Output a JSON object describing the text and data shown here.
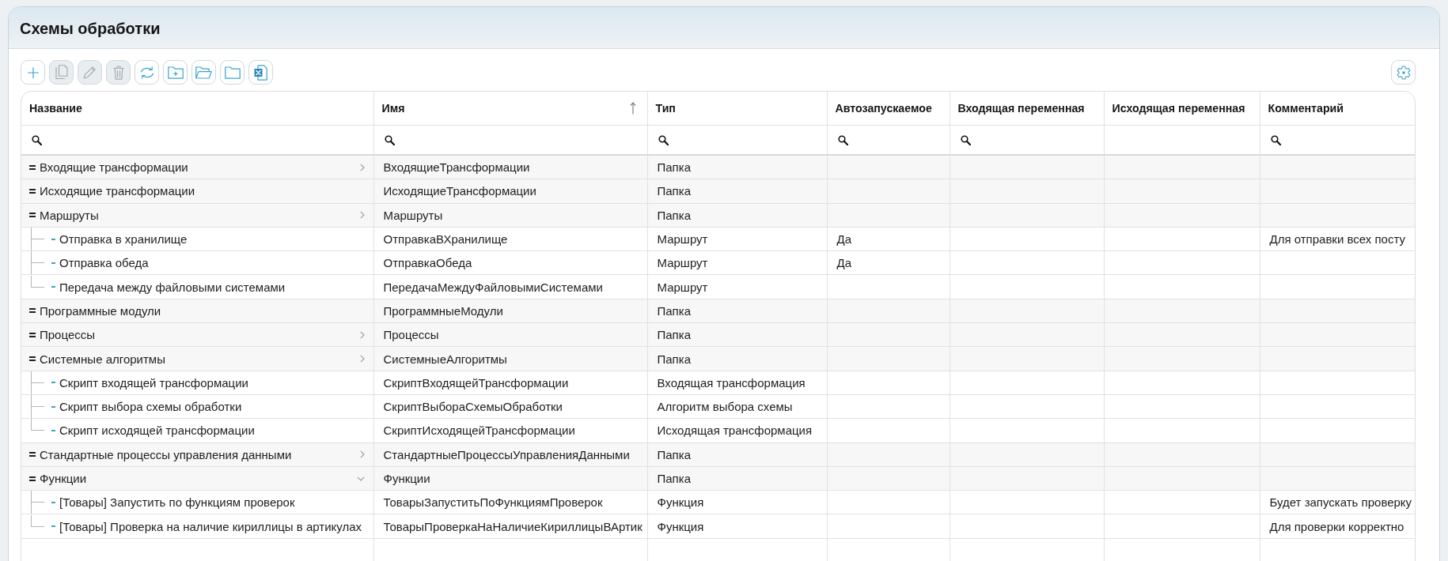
{
  "title": "Схемы обработки",
  "toolbar": {
    "left": [
      {
        "kind": "add",
        "disabled": false
      },
      {
        "kind": "copy",
        "disabled": true
      },
      {
        "kind": "edit",
        "disabled": true
      },
      {
        "kind": "delete",
        "disabled": true
      },
      {
        "kind": "refresh",
        "disabled": false
      },
      {
        "kind": "new-folder",
        "disabled": false
      },
      {
        "kind": "open-folder",
        "disabled": false
      },
      {
        "kind": "folder",
        "disabled": false
      },
      {
        "kind": "excel",
        "disabled": false
      }
    ],
    "right": [
      {
        "kind": "settings",
        "disabled": false
      }
    ]
  },
  "table": {
    "columns": [
      {
        "label": "Название",
        "filter": true,
        "sorted": false
      },
      {
        "label": "Имя",
        "filter": true,
        "sorted": true
      },
      {
        "label": "Тип",
        "filter": true,
        "sorted": false
      },
      {
        "label": "Автозапускаемое",
        "filter": true,
        "sorted": false
      },
      {
        "label": "Входящая переменная",
        "filter": true,
        "sorted": false
      },
      {
        "label": "Исходящая переменная",
        "filter": false,
        "sorted": false
      },
      {
        "label": "Комментарий",
        "filter": true,
        "sorted": false
      }
    ],
    "rows": [
      {
        "title": "Входящие трансформации",
        "name": "ВходящиеТрансформации",
        "type": "Папка",
        "expander": true,
        "expanded": false
      },
      {
        "title": "Исходящие трансформации",
        "name": "ИсходящиеТрансформации",
        "type": "Папка",
        "expander": false
      },
      {
        "title": "Маршруты",
        "name": "Маршруты",
        "type": "Папка",
        "expander": true,
        "expanded": false,
        "children": [
          {
            "title": "Отправка в хранилище",
            "name": "ОтправкаВХранилище",
            "type": "Маршрут",
            "autostart": "Да",
            "comment": "Для отправки всех посту"
          },
          {
            "title": "Отправка обеда",
            "name": "ОтправкаОбеда",
            "type": "Маршрут",
            "autostart": "Да"
          },
          {
            "title": "Передача между файловыми системами",
            "name": "ПередачаМеждуФайловымиСистемами",
            "type": "Маршрут"
          }
        ]
      },
      {
        "title": "Программные модули",
        "name": "ПрограммныеМодули",
        "type": "Папка",
        "expander": false
      },
      {
        "title": "Процессы",
        "name": "Процессы",
        "type": "Папка",
        "expander": true,
        "expanded": false
      },
      {
        "title": "Системные алгоритмы",
        "name": "СистемныеАлгоритмы",
        "type": "Папка",
        "expander": true,
        "expanded": false,
        "children": [
          {
            "title": "Скрипт входящей трансформации",
            "name": "СкриптВходящейТрансформации",
            "type": "Входящая трансформация"
          },
          {
            "title": "Скрипт выбора схемы обработки",
            "name": "СкриптВыбораСхемыОбработки",
            "type": "Алгоритм выбора схемы"
          },
          {
            "title": "Скрипт исходящей трансформации",
            "name": "СкриптИсходящейТрансформации",
            "type": "Исходящая трансформация"
          }
        ]
      },
      {
        "title": "Стандартные процессы управления данными",
        "name": "СтандартныеПроцессыУправленияДанными",
        "type": "Папка",
        "expander": true,
        "expanded": false
      },
      {
        "title": "Функции",
        "name": "Функции",
        "type": "Папка",
        "expander": true,
        "expanded": true,
        "children": [
          {
            "title": "[Товары] Запустить по функциям проверок",
            "name": "ТоварыЗапуститьПоФункциямПроверок",
            "type": "Функция",
            "comment": "Будет запускать проверку"
          },
          {
            "title": "[Товары] Проверка на наличие кириллицы в артикулах",
            "name": "ТоварыПроверкаНаНаличиеКириллицыВАртик",
            "type": "Функция",
            "comment": "Для проверки корректно"
          }
        ]
      }
    ]
  }
}
